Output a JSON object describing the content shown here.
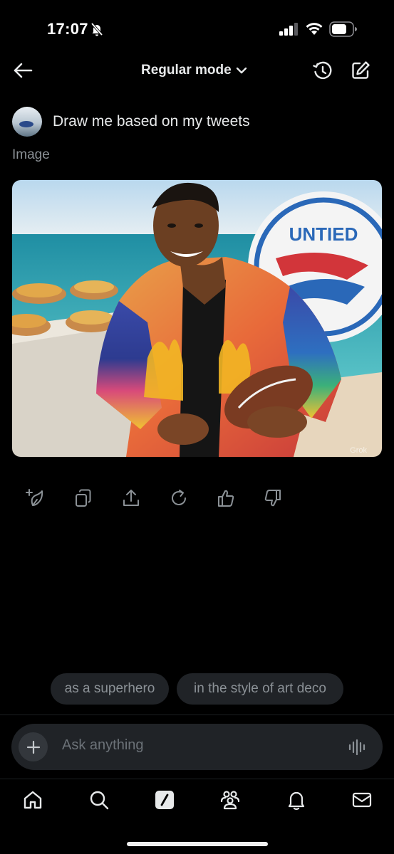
{
  "status_bar": {
    "time": "17:07",
    "icons": [
      "bell-off-icon",
      "cellular-signal-icon",
      "wifi-icon",
      "battery-icon"
    ]
  },
  "header": {
    "mode_label": "Regular mode",
    "icons": [
      "back-arrow-icon",
      "chevron-down-icon",
      "history-icon",
      "compose-icon"
    ]
  },
  "conversation": {
    "user_prompt": "Draw me based on my tweets",
    "response_label": "Image",
    "image": {
      "sign_text": "UNTIED",
      "watermark": "Grok"
    },
    "actions": [
      "regenerate-sparkle-icon",
      "copy-icon",
      "share-icon",
      "refresh-icon",
      "thumbs-up-icon",
      "thumbs-down-icon"
    ]
  },
  "suggestions": [
    "as a superhero",
    "in the style of art deco"
  ],
  "input": {
    "placeholder": "Ask anything",
    "icons": [
      "plus-icon",
      "voice-icon"
    ]
  },
  "bottom_nav": [
    "home-icon",
    "search-icon",
    "grok-icon",
    "communities-icon",
    "notifications-icon",
    "messages-icon"
  ],
  "colors": {
    "background": "#000000",
    "surface": "#202327",
    "text_primary": "#e7e9ea",
    "text_secondary": "#8b9196"
  }
}
